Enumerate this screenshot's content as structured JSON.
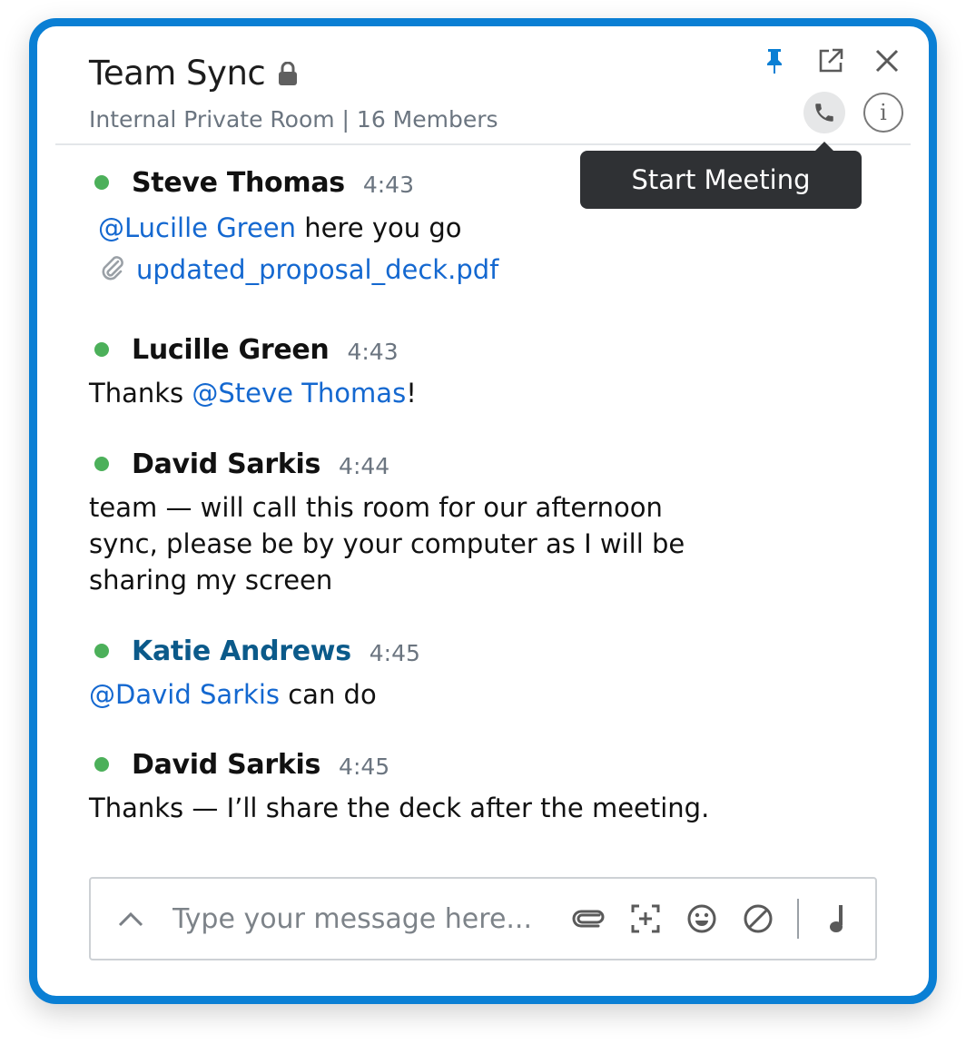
{
  "header": {
    "title": "Team Sync",
    "subtitle": "Internal Private Room | 16 Members",
    "tooltip": "Start Meeting"
  },
  "messages": [
    {
      "author": "Steve Thomas",
      "time": "4:43",
      "mention": "@Lucille Green",
      "text_after": " here you go",
      "attachment": "updated_proposal_deck.pdf"
    },
    {
      "author": "Lucille Green",
      "time": "4:43",
      "text_before": "Thanks ",
      "mention": "@Steve Thomas",
      "text_after": "!"
    },
    {
      "author": "David Sarkis",
      "time": "4:44",
      "lines": [
        "team — will call this room for our afternoon",
        "sync, please be by your computer as I will be",
        "sharing my screen"
      ]
    },
    {
      "author": "Katie Andrews",
      "time": "4:45",
      "mention": "@David Sarkis",
      "text_after": " can do"
    },
    {
      "author": "David Sarkis",
      "time": "4:45",
      "text": "Thanks — I’ll share the deck after the meeting."
    }
  ],
  "composer": {
    "placeholder": "Type your message here..."
  },
  "colors": {
    "accent": "#0a7fd4",
    "mention": "#1468d0",
    "online": "#4cb05a",
    "pin": "#0a7fd4"
  },
  "icons": [
    "lock-icon",
    "pin-icon",
    "popout-icon",
    "close-icon",
    "phone-icon",
    "info-icon",
    "paperclip-icon",
    "chevron-up-icon",
    "attach-icon",
    "screenshot-icon",
    "emoji-icon",
    "block-icon",
    "music-note-icon"
  ]
}
